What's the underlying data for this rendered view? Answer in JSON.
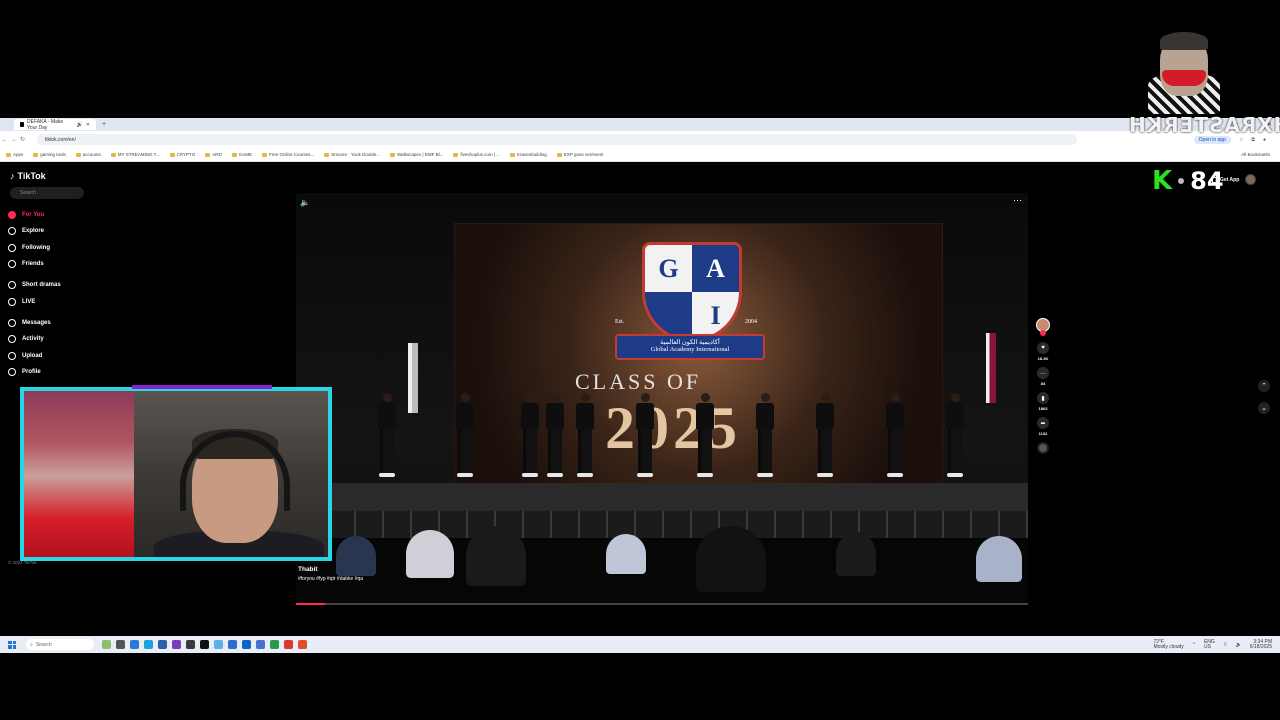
{
  "browser": {
    "tab_title": "DEFAKA - Make Your Day",
    "new_tab": "+",
    "url": "tiktok.com/en/",
    "open_in_app": "Open in app",
    "bookmarks": [
      "Apps",
      "gaming tools",
      "accounts",
      "MY STREAMING T...",
      "CRYPTO",
      "ARD",
      "GAME",
      "Free Online Courses...",
      "Smoore · Yook Double...",
      "Walkscapes | EMF Bl...",
      "fiveshoplus.com | ...",
      "Kravenbuilding",
      "EXP goes ver/event"
    ],
    "all_bookmarks": "All Bookmarks"
  },
  "tiktok": {
    "brand": "TikTok",
    "search_placeholder": "Search",
    "menu": [
      {
        "label": "For You",
        "active": true
      },
      {
        "label": "Explore"
      },
      {
        "label": "Following"
      },
      {
        "label": "Friends"
      },
      {
        "label": "Short dramas"
      },
      {
        "label": "LIVE"
      },
      {
        "label": "Messages"
      },
      {
        "label": "Activity"
      },
      {
        "label": "Upload"
      },
      {
        "label": "Profile"
      }
    ],
    "copyright": "© 2024 TikTok",
    "get_app": "Get App",
    "video": {
      "author": "Thabit",
      "tags": "#foryou #fyp #qtr #dabke #qa",
      "progress_percent": 4,
      "screen": {
        "letters": [
          "G",
          "A",
          "",
          "I"
        ],
        "est_left": "Est.",
        "est_right": "2004",
        "arabic": "أكاديمية الكون العالمية",
        "english": "Global Academy International",
        "class_of": "CLASS OF",
        "year": "2025"
      }
    },
    "actions": {
      "likes": "18.3K",
      "comments": "84",
      "bookmarks": "1863",
      "shares": "1132"
    }
  },
  "overlay": {
    "name": "HXRASTERKH",
    "k_letter": "K",
    "count": "84"
  },
  "taskbar": {
    "search": "Search",
    "weather_temp": "72°F",
    "weather_desc": "Mostly cloudy",
    "lang": "ENG",
    "region": "US",
    "time": "3:34 PM",
    "date": "6/18/2025"
  }
}
